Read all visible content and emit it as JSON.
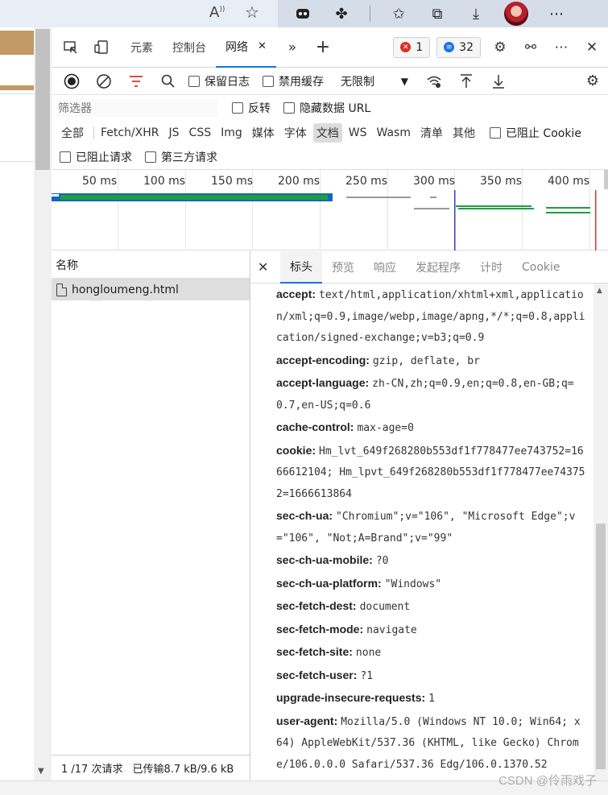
{
  "browser": {
    "read_aloud_icon": "read-aloud-icon",
    "favorite_icon": "favorite-add-icon"
  },
  "devtools": {
    "tabs": [
      {
        "label": "元素"
      },
      {
        "label": "控制台"
      },
      {
        "label": "网络"
      }
    ],
    "error_count": "1",
    "message_count": "32"
  },
  "toolbar": {
    "preserve_log": "保留日志",
    "disable_cache": "禁用缓存",
    "throttling": "无限制"
  },
  "filter": {
    "placeholder": "筛选器",
    "invert": "反转",
    "hide_data_url": "隐藏数据 URL",
    "types": [
      "全部",
      "Fetch/XHR",
      "JS",
      "CSS",
      "Img",
      "媒体",
      "字体",
      "文档",
      "WS",
      "Wasm",
      "清单",
      "其他"
    ],
    "blocked_cookies": "已阻止 Cookie",
    "blocked_requests": "已阻止请求",
    "third_party": "第三方请求"
  },
  "overview": {
    "ticks": [
      "50 ms",
      "100 ms",
      "150 ms",
      "200 ms",
      "250 ms",
      "300 ms",
      "350 ms",
      "400 ms"
    ]
  },
  "list": {
    "column_name": "名称",
    "request_name": "hongloumeng.html",
    "status_requests": "1 /17 次请求",
    "status_transferred": "已传输8.7 kB/9.6 kB"
  },
  "details": {
    "tabs": [
      "标头",
      "预览",
      "响应",
      "发起程序",
      "计时",
      "Cookie"
    ],
    "headers": [
      {
        "k": "accept:",
        "v": "text/html,application/xhtml+xml,application/xml;q=0.9,image/webp,image/apng,*/*;q=0.8,application/signed-exchange;v=b3;q=0.9"
      },
      {
        "k": "accept-encoding:",
        "v": "gzip, deflate, br"
      },
      {
        "k": "accept-language:",
        "v": "zh-CN,zh;q=0.9,en;q=0.8,en-GB;q=0.7,en-US;q=0.6"
      },
      {
        "k": "cache-control:",
        "v": "max-age=0"
      },
      {
        "k": "cookie:",
        "v": "Hm_lvt_649f268280b553df1f778477ee743752=1666612104; Hm_lpvt_649f268280b553df1f778477ee743752=1666613864"
      },
      {
        "k": "sec-ch-ua:",
        "v": "\"Chromium\";v=\"106\", \"Microsoft Edge\";v=\"106\", \"Not;A=Brand\";v=\"99\""
      },
      {
        "k": "sec-ch-ua-mobile:",
        "v": "?0"
      },
      {
        "k": "sec-ch-ua-platform:",
        "v": "\"Windows\""
      },
      {
        "k": "sec-fetch-dest:",
        "v": "document"
      },
      {
        "k": "sec-fetch-mode:",
        "v": "navigate"
      },
      {
        "k": "sec-fetch-site:",
        "v": "none"
      },
      {
        "k": "sec-fetch-user:",
        "v": "?1"
      },
      {
        "k": "upgrade-insecure-requests:",
        "v": "1"
      },
      {
        "k": "user-agent:",
        "v": "Mozilla/5.0 (Windows NT 10.0; Win64; x64) AppleWebKit/537.36 (KHTML, like Gecko) Chrome/106.0.0.0 Safari/537.36 Edg/106.0.1370.52"
      }
    ]
  },
  "watermark": "CSDN @伶雨戏子",
  "colors": {
    "accent": "#1a73e8",
    "error": "#d93025",
    "info": "#1a73e8",
    "record": "#222222",
    "filter_icon": "#d93025",
    "waterfall_green": "#1e9e3e",
    "waterfall_blue": "#1565c0"
  }
}
